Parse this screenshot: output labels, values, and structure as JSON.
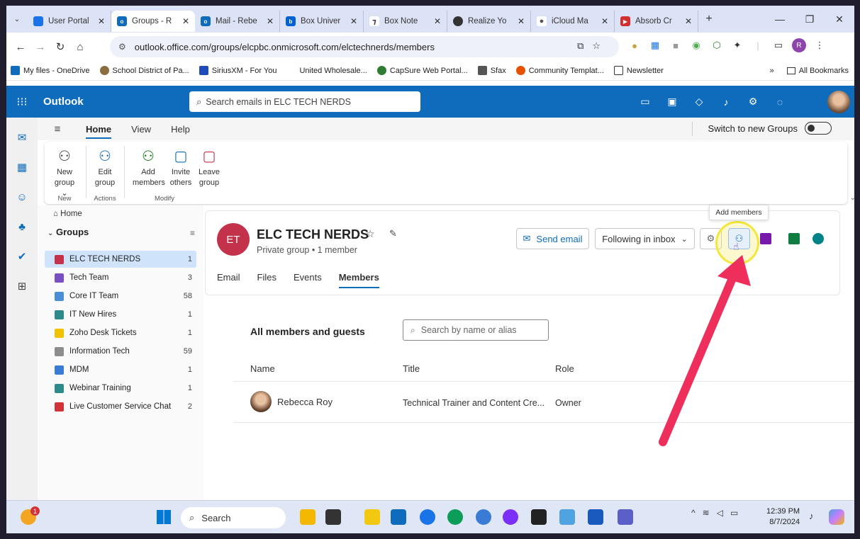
{
  "browser": {
    "tabs": [
      {
        "label": "User Portal",
        "color": "#1a73e8"
      },
      {
        "label": "Groups - R",
        "color": "#0f6cbd",
        "active": true
      },
      {
        "label": "Mail - Rebe",
        "color": "#0f6cbd"
      },
      {
        "label": "Box Univer",
        "color": "#0061d5"
      },
      {
        "label": "Box Note",
        "color": "#333333"
      },
      {
        "label": "Realize Yo",
        "color": "#333333"
      },
      {
        "label": "iCloud Ma",
        "color": "#888888"
      },
      {
        "label": "Absorb Cr",
        "color": "#d32f2f"
      }
    ],
    "url": "outlook.office.com/groups/elcpbc.onmicrosoft.com/elctechnerds/members",
    "profile_initial": "R",
    "bookmarks": [
      {
        "label": "My files - OneDrive",
        "color": "#0f6cbd"
      },
      {
        "label": "School District of Pa...",
        "color": "#8b6d3f"
      },
      {
        "label": "SiriusXM - For You",
        "color": "#1e4bb8"
      },
      {
        "label": "United Wholesale...",
        "color": "#ffffff"
      },
      {
        "label": "CapSure Web Portal...",
        "color": "#2e7d32"
      },
      {
        "label": "Sfax",
        "color": "#555555"
      },
      {
        "label": "Community Templat...",
        "color": "#e65100"
      },
      {
        "label": "Newsletter",
        "color": "#ffffff"
      }
    ],
    "more_bookmarks": "»",
    "all_bookmarks": "All Bookmarks"
  },
  "outlook": {
    "app_name": "Outlook",
    "search_placeholder": "Search emails in ELC TECH NERDS",
    "ribbon_tabs": [
      "Home",
      "View",
      "Help"
    ],
    "switch_label": "Switch to new Groups",
    "ribbon": {
      "new_group": "New group ⌄",
      "new_label": "New",
      "edit_group": "Edit group",
      "actions_label": "Actions",
      "add_members": "Add members",
      "invite_others": "Invite others",
      "leave_group": "Leave group",
      "modify_label": "Modify"
    },
    "folder": {
      "home": "Home",
      "groups_heading": "Groups",
      "groups": [
        {
          "name": "ELC TECH NERDS",
          "count": "1",
          "color": "#c4314b",
          "selected": true
        },
        {
          "name": "Tech Team",
          "count": "3",
          "color": "#7b4fc4"
        },
        {
          "name": "Core IT Team",
          "count": "58",
          "color": "#4a8fd6"
        },
        {
          "name": "IT New Hires",
          "count": "1",
          "color": "#2e8b8b"
        },
        {
          "name": "Zoho Desk Tickets",
          "count": "1",
          "color": "#f2c200"
        },
        {
          "name": "Information Tech",
          "count": "59",
          "color": "#8c8c8c"
        },
        {
          "name": "MDM",
          "count": "1",
          "color": "#3a7bd5"
        },
        {
          "name": "Webinar Training",
          "count": "1",
          "color": "#2e8b8b"
        },
        {
          "name": "Live Customer Service Chat",
          "count": "2",
          "color": "#d13438"
        }
      ]
    },
    "group": {
      "initials": "ET",
      "name": "ELC TECH NERDS",
      "subtitle": "Private group • 1 member",
      "tabs": [
        "Email",
        "Files",
        "Events",
        "Members"
      ],
      "active_tab": "Members",
      "send_email": "Send email",
      "following": "Following in inbox",
      "tooltip": "Add members"
    },
    "members": {
      "heading": "All members and guests",
      "search_placeholder": "Search by name or alias",
      "columns": [
        "Name",
        "Title",
        "Role"
      ],
      "rows": [
        {
          "name": "Rebecca Roy",
          "title": "Technical Trainer and Content Cre...",
          "role": "Owner"
        }
      ]
    }
  },
  "taskbar": {
    "search": "Search",
    "time": "12:39 PM",
    "date": "8/7/2024",
    "notification_badge": "1"
  }
}
